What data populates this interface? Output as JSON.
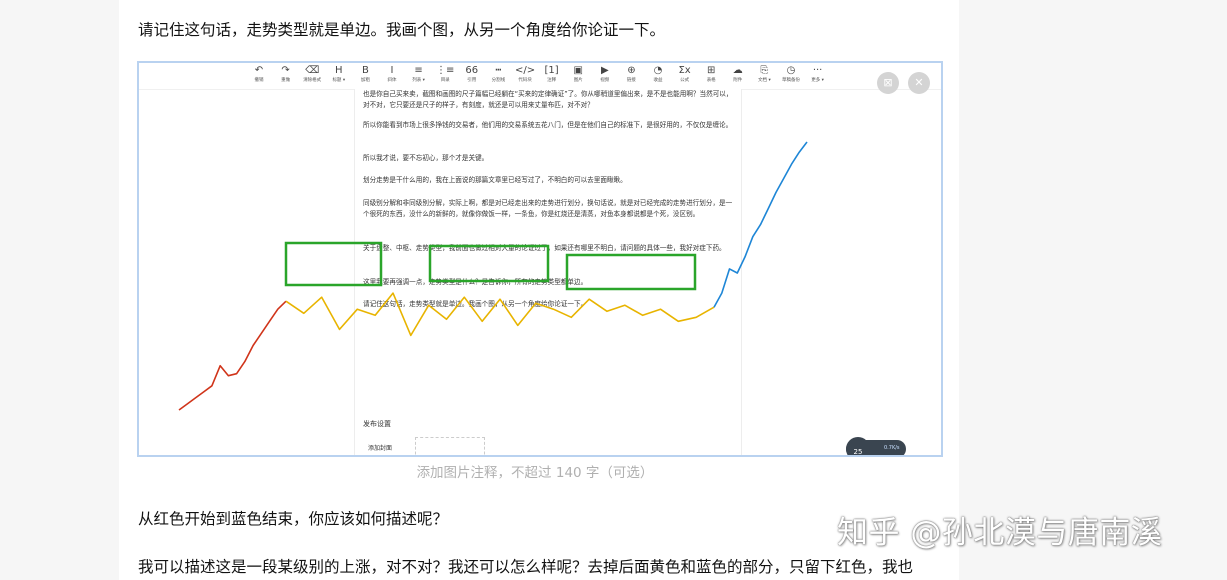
{
  "article": {
    "intro_text": "请记住这句话，走势类型就是单边。我画个图，从另一个角度给你论证一下。",
    "caption_placeholder": "添加图片注释，不超过 140 字（可选）",
    "question_text": "从红色开始到蓝色结束，你应该如何描述呢？",
    "answer_text": "我可以描述这是一段某级别的上涨，对不对？我还可以怎么样呢？去掉后面黄色和蓝色的部分，只留下红色，我也"
  },
  "editor_toolbar": [
    {
      "icon": "↶",
      "label": "撤销"
    },
    {
      "icon": "↷",
      "label": "重做"
    },
    {
      "icon": "⌫",
      "label": "清除格式"
    },
    {
      "icon": "H",
      "label": "标题 ▾"
    },
    {
      "icon": "B",
      "label": "加粗"
    },
    {
      "icon": "I",
      "label": "斜体"
    },
    {
      "icon": "≡",
      "label": "列表 ▾"
    },
    {
      "icon": "⋮≡",
      "label": "目录"
    },
    {
      "icon": "66",
      "label": "引用"
    },
    {
      "icon": "┅",
      "label": "分割线"
    },
    {
      "icon": "</>",
      "label": "代码块"
    },
    {
      "icon": "[1]",
      "label": "注释"
    },
    {
      "icon": "▣",
      "label": "图片"
    },
    {
      "icon": "▶",
      "label": "视频"
    },
    {
      "icon": "⊕",
      "label": "链接"
    },
    {
      "icon": "◔",
      "label": "收益"
    },
    {
      "icon": "Σx",
      "label": "公式"
    },
    {
      "icon": "⊞",
      "label": "表格"
    },
    {
      "icon": "☁",
      "label": "附件"
    },
    {
      "icon": "⎘",
      "label": "文档 ▾"
    },
    {
      "icon": "◷",
      "label": "草稿备份"
    },
    {
      "icon": "···",
      "label": "更多 ▾"
    }
  ],
  "embedded_doc": {
    "paragraphs": [
      "也是你自己买来卖，截图和画图的尺子篇幅已经躺在“买来的定律确证”了。你从哪稍道里偏出来，是不是也能用啊？当然可以，对不对，它只要还是尺子的样子，有刻度，就还是可以用来丈量布匹，对不对？",
      "所以你能看到市场上很多挣钱的交易者，他们用的交易系统五花八门，但是在他们自己的标准下，是很好用的，不仅仅是缠论。",
      "所以我才说，要不忘初心，那个才是关键。",
      "划分走势是干什么用的，我在上面说的那篇文章里已经写过了，不明白的可以去里面瞅瞅。",
      "同级别分解和非同级别分解，实际上啊，都是对已经走出来的走势进行划分，换句话说，就是对已经完成的走势进行划分，是一个很死的东西，没什么的新鲜的，就像你做饭一样，一条鱼，你是红烧还是清蒸，对鱼本身都说都是个死，没区别。",
      "关于盘整、中枢、走势类型，我前面也做过相对大量的论证过了，如果还有哪里不明白，请问题的具体一些，我好对症下药。",
      "这里我要再强调一点，走势类型是什么？是告诉你，所有的走势类型都单边。",
      "请记住这句话，走势类型就是单边。我画个图，从另一个角度给你论证一下。"
    ],
    "publish_settings_title": "发布设置",
    "cover_label": "添加封面"
  },
  "float_widget": {
    "score": "25",
    "speed": "0.7K/s"
  },
  "watermark_text": "知乎 @孙北漠与唐南溪",
  "chart_data": {
    "type": "line",
    "title": "",
    "series": [
      {
        "color_name": "red",
        "color": "#d0341a",
        "values": [
          0,
          3,
          6,
          9,
          12,
          22,
          17,
          18,
          24,
          32,
          38,
          44,
          50,
          54
        ]
      },
      {
        "color_name": "yellow",
        "color": "#e8b400",
        "values": [
          54,
          48,
          56,
          40,
          50,
          47,
          58,
          37,
          52,
          45,
          56,
          44,
          55,
          42,
          53,
          50,
          46,
          55,
          49,
          52,
          47,
          50,
          44,
          46,
          51
        ]
      },
      {
        "color_name": "blue",
        "color": "#1e86d6",
        "values": [
          51,
          58,
          70,
          68,
          76,
          86,
          92,
          100,
          108,
          115,
          122,
          128,
          133
        ]
      }
    ],
    "annotations": [
      {
        "type": "box",
        "color": "#2aa52a",
        "label": "green-box-1"
      },
      {
        "type": "box",
        "color": "#2aa52a",
        "label": "green-box-2"
      },
      {
        "type": "box",
        "color": "#2aa52a",
        "label": "green-box-3"
      }
    ]
  },
  "colors": {
    "red_line": "#d0341a",
    "yellow_line": "#e8b400",
    "blue_line": "#1e86d6",
    "green_box": "#2aa52a",
    "frame_border": "#b9d2f0"
  }
}
